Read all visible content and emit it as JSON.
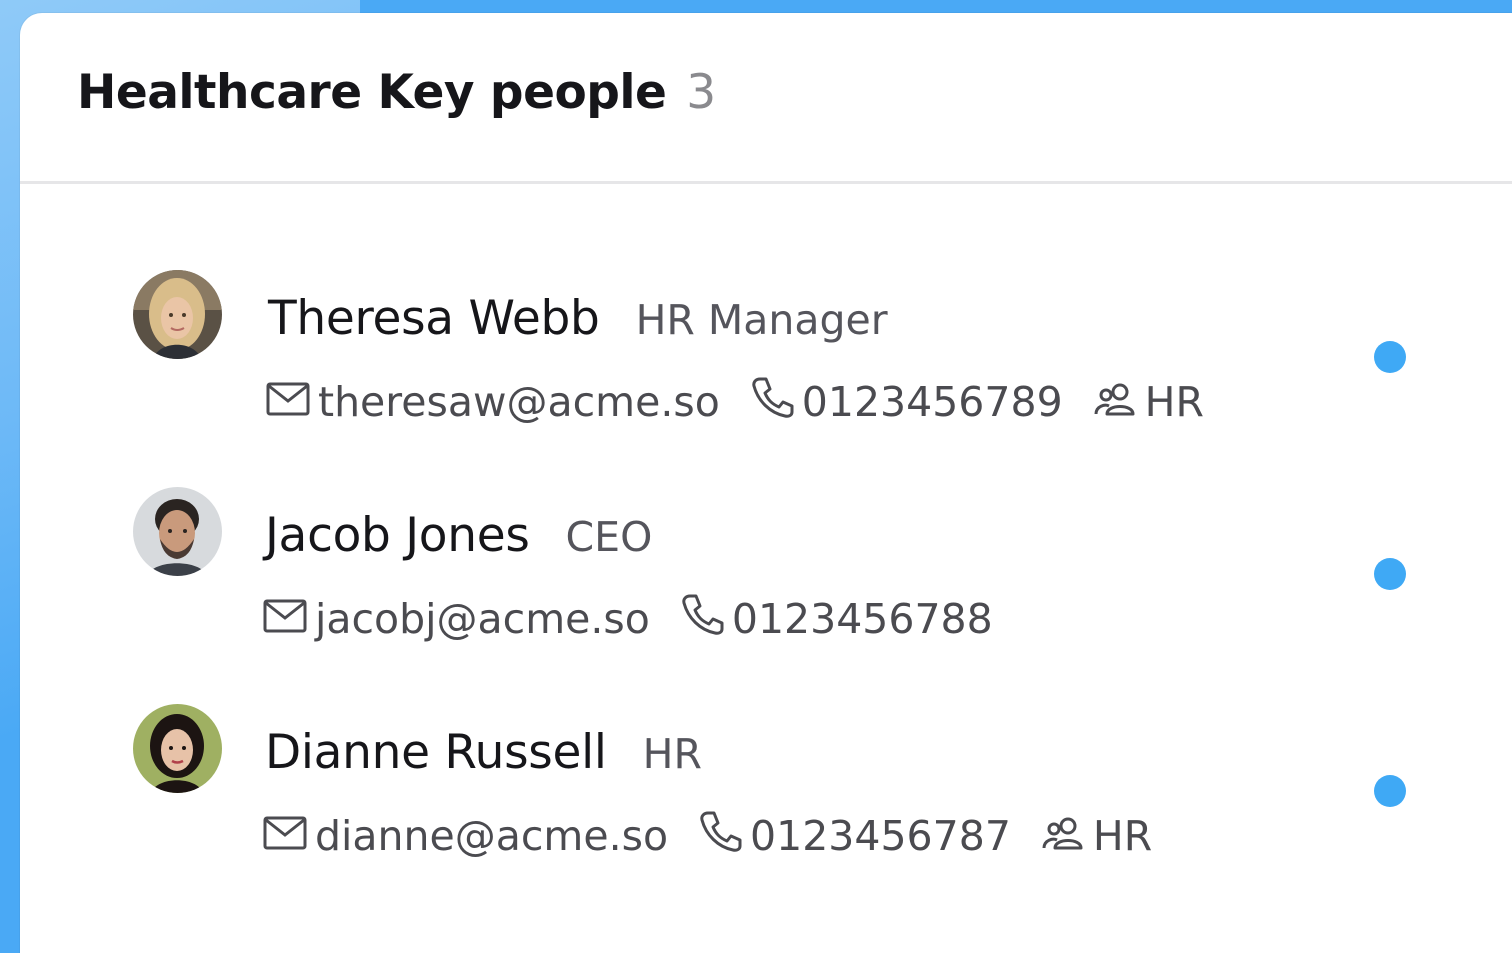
{
  "panel": {
    "title": "Healthcare Key people",
    "count": "3"
  },
  "people": [
    {
      "name": "Theresa Webb",
      "role": "HR Manager",
      "email": "theresaw@acme.so",
      "phone": "0123456789",
      "department": "HR"
    },
    {
      "name": "Jacob Jones",
      "role": "CEO",
      "email": "jacobj@acme.so",
      "phone": "0123456788"
    },
    {
      "name": "Dianne Russell",
      "role": "HR",
      "email": "dianne@acme.so",
      "phone": "0123456787",
      "department": "HR"
    }
  ],
  "icons": {
    "email": "mail-icon",
    "phone": "phone-icon",
    "department": "users-icon"
  },
  "colors": {
    "status_dot": "#3fa9f5",
    "background": "#4aa9f5"
  }
}
